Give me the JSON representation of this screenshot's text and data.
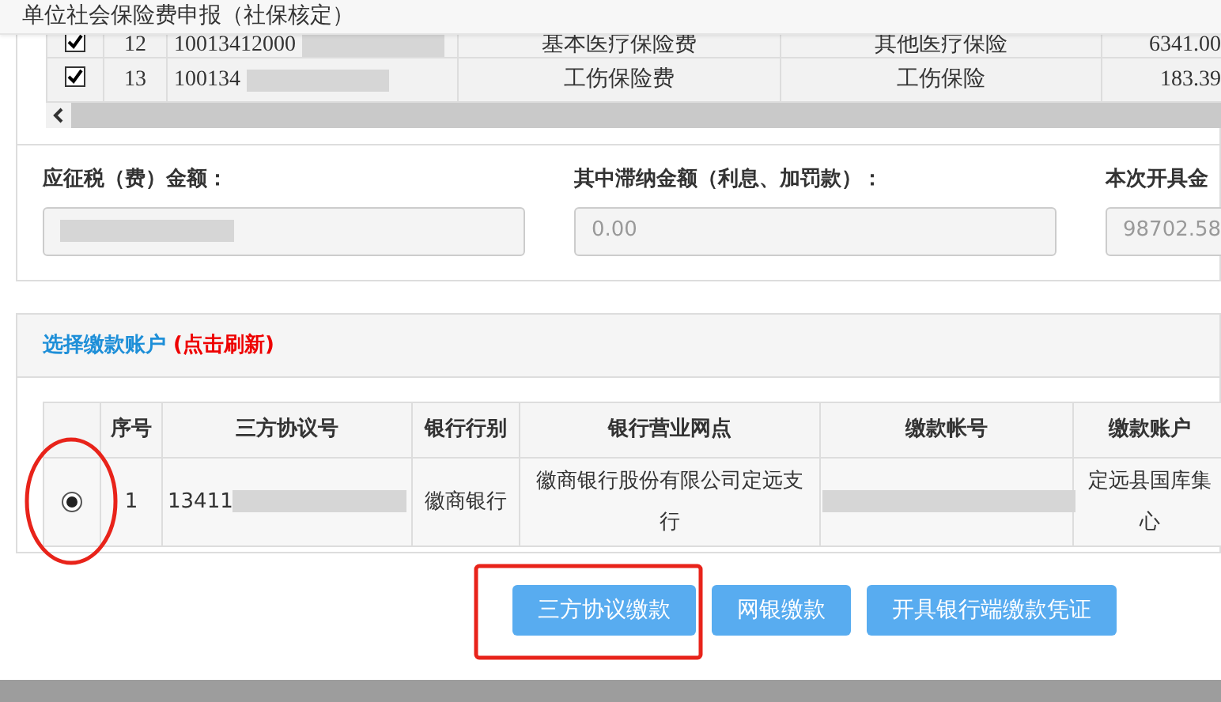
{
  "dialog": {
    "title": "单位社会保险费申报（社保核定）"
  },
  "items_table": {
    "rows": [
      {
        "checked": true,
        "no": "12",
        "code": "10013412000",
        "item": "基本医疗保险费",
        "kind": "其他医疗保险",
        "amount": "6341.00"
      },
      {
        "checked": true,
        "no": "13",
        "code": "100134",
        "item": "工伤保险费",
        "kind": "工伤保险",
        "amount": "183.39"
      }
    ]
  },
  "amount_fields": [
    {
      "label": "应征税（费）金额："
    },
    {
      "label": "其中滞纳金额（利息、加罚款）：",
      "value": "0.00"
    },
    {
      "label": "本次开具金",
      "value": "98702.58"
    }
  ],
  "account_panel": {
    "title": "选择缴款账户",
    "refresh": "(点击刷新)",
    "columns": [
      "序号",
      "三方协议号",
      "银行行别",
      "银行营业网点",
      "缴款帐号",
      "缴款账户"
    ],
    "rows": [
      {
        "selected": true,
        "no": "1",
        "agreement": "13411",
        "bank": "徽商银行",
        "branch": "徽商银行股份有限公司定远支行",
        "account_name": [
          "定远县国库集",
          "心"
        ]
      }
    ]
  },
  "buttons": [
    "三方协议缴款",
    "网银缴款",
    "开具银行端缴款凭证"
  ]
}
